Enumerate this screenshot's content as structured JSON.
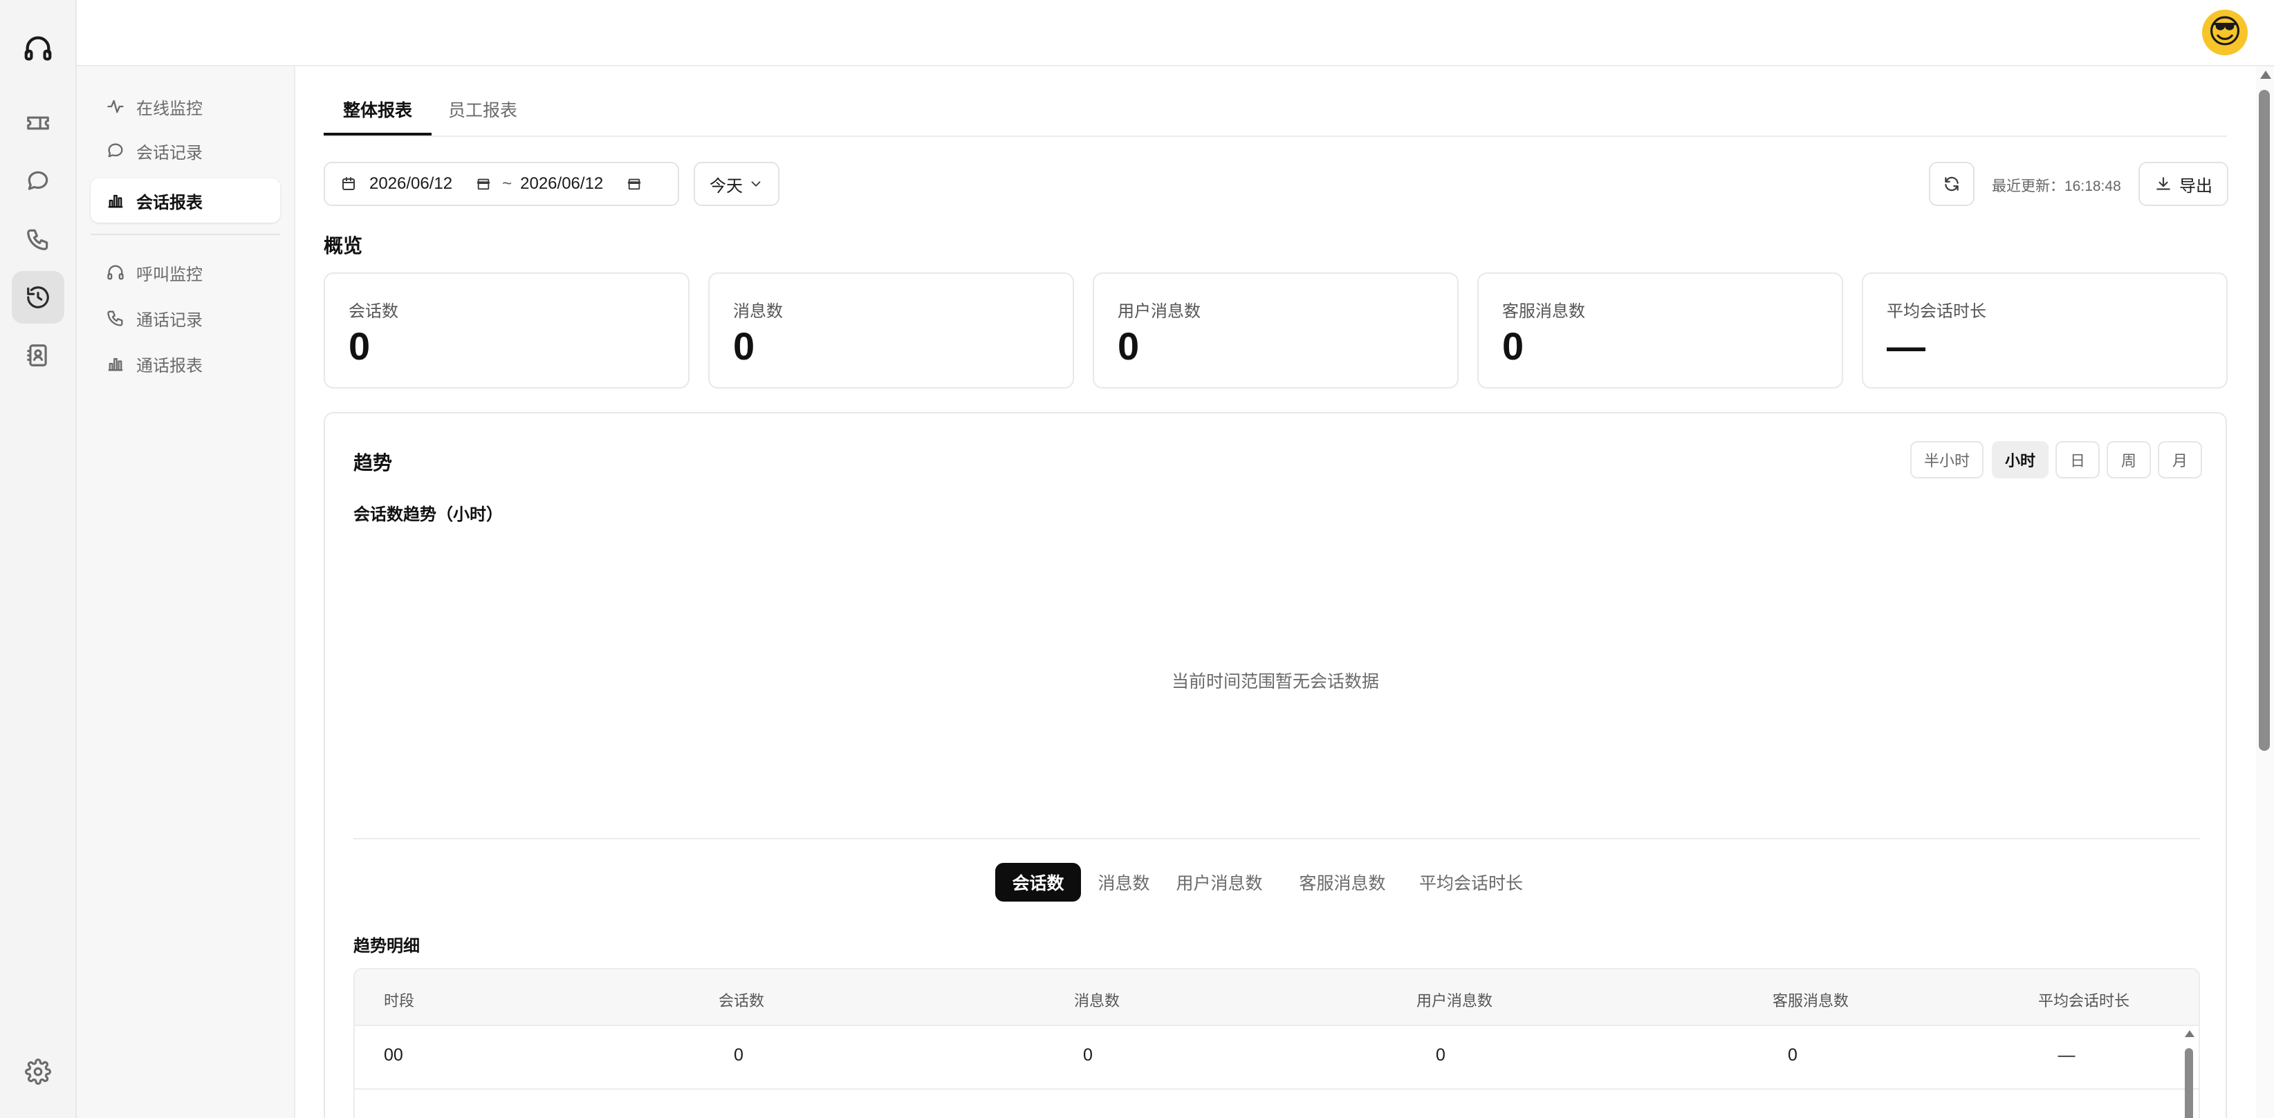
{
  "subnav": {
    "items": [
      {
        "label": "在线监控",
        "icon": "activity-icon"
      },
      {
        "label": "会话记录",
        "icon": "chat-bubble-icon"
      },
      {
        "label": "会话报表",
        "icon": "bar-chart-icon",
        "active": true
      },
      {
        "label": "呼叫监控",
        "icon": "headset-icon"
      },
      {
        "label": "通话记录",
        "icon": "phone-icon"
      },
      {
        "label": "通话报表",
        "icon": "bar-chart-icon"
      }
    ]
  },
  "tabs": [
    "整体报表",
    "员工报表"
  ],
  "filters": {
    "start_date": "2026/06/12",
    "separator": "~",
    "end_date": "2026/06/12",
    "range_select": "今天",
    "last_update": "最近更新：16:18:48",
    "export_label": "导出"
  },
  "overview": {
    "title": "概览",
    "cards": [
      {
        "label": "会话数",
        "value": "0"
      },
      {
        "label": "消息数",
        "value": "0"
      },
      {
        "label": "用户消息数",
        "value": "0"
      },
      {
        "label": "客服消息数",
        "value": "0"
      },
      {
        "label": "平均会话时长",
        "value": "—"
      }
    ]
  },
  "trend": {
    "title": "趋势",
    "granularity": [
      "半小时",
      "小时",
      "日",
      "周",
      "月"
    ],
    "granularity_active": "小时",
    "chart_title": "会话数趋势（小时）",
    "empty_text": "当前时间范围暂无会话数据",
    "metric_tabs": [
      "会话数",
      "消息数",
      "用户消息数",
      "客服消息数",
      "平均会话时长"
    ],
    "metric_active": "会话数",
    "detail_title": "趋势明细",
    "table": {
      "headers": [
        "时段",
        "会话数",
        "消息数",
        "用户消息数",
        "客服消息数",
        "平均会话时长"
      ],
      "rows": [
        [
          "00",
          "0",
          "0",
          "0",
          "0",
          "—"
        ]
      ]
    }
  }
}
